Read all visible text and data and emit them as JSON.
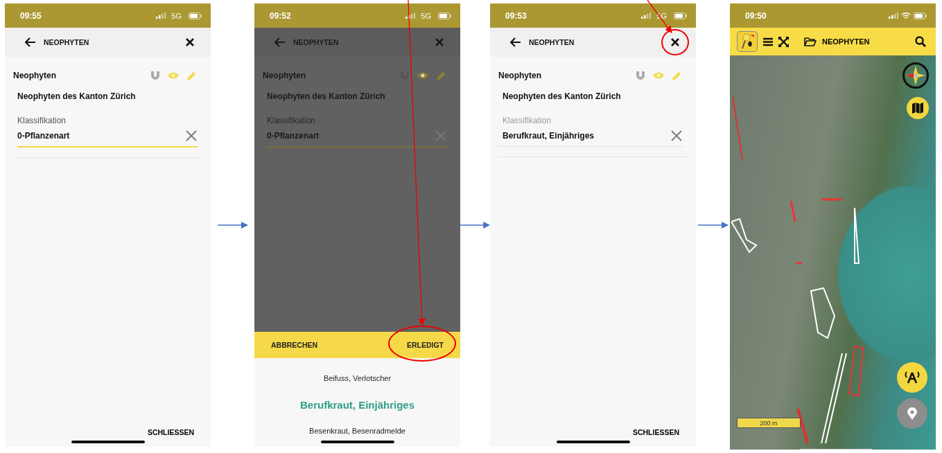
{
  "screens": [
    {
      "kind": "form",
      "status": {
        "time": "09:55",
        "connection": {
          "kind": "cellular",
          "label": "5G"
        }
      },
      "header": {
        "title": "NEOPHYTEN"
      },
      "dimmed": false,
      "layer_name": "Neophyten",
      "layer_title": "Neophyten des Kanton Zürich",
      "field": {
        "label": "Klassifikation",
        "value": "0-Pflanzenart",
        "focused": true
      },
      "footer_button": "SCHLIESSEN"
    },
    {
      "kind": "form",
      "status": {
        "time": "09:52",
        "connection": {
          "kind": "cellular",
          "label": "5G"
        }
      },
      "header": {
        "title": "NEOPHYTEN"
      },
      "dimmed": true,
      "layer_name": "Neophyten",
      "layer_title": "Neophyten des Kanton Zürich",
      "field": {
        "label": "Klassifikation",
        "value": "0-Pflanzenart",
        "focused": true
      },
      "picker": {
        "cancel": "ABBRECHEN",
        "done": "ERLEDIGT",
        "done_highlighted": true,
        "options": [
          {
            "label": "Beifuss, Verlotscher",
            "selected": false
          },
          {
            "label": "Berufkraut, Einjähriges",
            "selected": true
          },
          {
            "label": "Besenkraut, Besenradmelde",
            "selected": false
          }
        ]
      }
    },
    {
      "kind": "form",
      "status": {
        "time": "09:53",
        "connection": {
          "kind": "cellular",
          "label": "5G"
        }
      },
      "header": {
        "title": "NEOPHYTEN",
        "close_highlighted": true
      },
      "dimmed": false,
      "layer_name": "Neophyten",
      "layer_title": "Neophyten des Kanton Zürich",
      "field": {
        "label": "Klassifikation",
        "value": "Berufkraut, Einjähriges",
        "focused": false
      },
      "footer_button": "SCHLIESSEN"
    },
    {
      "kind": "map",
      "status": {
        "time": "09:50",
        "connection": {
          "kind": "wifi"
        }
      },
      "toolbar": {
        "title": "NEOPHYTEN"
      },
      "scale": "200 m"
    }
  ]
}
